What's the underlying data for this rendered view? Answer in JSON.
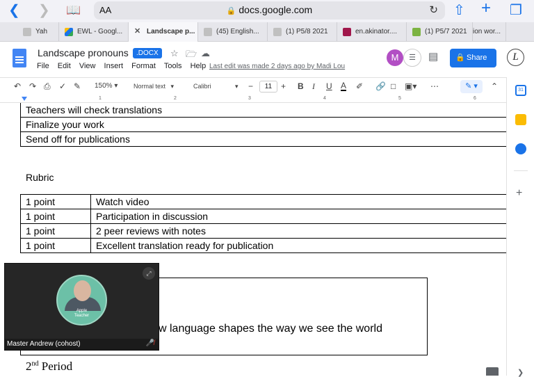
{
  "safari": {
    "aa": "AA",
    "url": "docs.google.com",
    "lock_icon": "lock-icon"
  },
  "tabs": [
    {
      "label": "Yah",
      "color": "#d93025"
    },
    {
      "label": "EWL - Googl...",
      "color": "#1a73e8"
    },
    {
      "label": "Landscape p...",
      "color": "#5f6368"
    },
    {
      "label": "(45) English...",
      "color": "#c0c0c0"
    },
    {
      "label": "(1) P5/8 2021",
      "color": "#c0c0c0"
    },
    {
      "label": "en.akinator....",
      "color": "#a0174b"
    },
    {
      "label": "(1) P5/7 2021",
      "color": "#7cb342"
    },
    {
      "label": "ion wor...",
      "color": "#c0c0c0"
    }
  ],
  "doc": {
    "title": "Landscape pronouns",
    "badge": ".DOCX",
    "last_edit": "Last edit was made 2 days ago by Madi Lou",
    "menu": [
      "File",
      "Edit",
      "View",
      "Insert",
      "Format",
      "Tools",
      "Help"
    ],
    "share_label": "Share",
    "avatar_initial": "M",
    "user_initial": "L"
  },
  "toolbar": {
    "zoom": "150%",
    "style": "Normal text",
    "font": "Calibri",
    "font_size": "11"
  },
  "ruler": {
    "numbers": [
      "1",
      "2",
      "3",
      "4",
      "5",
      "6"
    ]
  },
  "content": {
    "steps": [
      "Teachers will check translations",
      "Finalize your work",
      "Send off for publications"
    ],
    "rubric_heading": "Rubric",
    "rubric": [
      {
        "points": "1 point",
        "item": "Watch video"
      },
      {
        "points": "1 point",
        "item": "Participation in discussion"
      },
      {
        "points": "1 point",
        "item": "2 peer reviews with notes"
      },
      {
        "points": "1 point",
        "item": "Excellent translation ready for publication"
      }
    ],
    "partial_line": "w language shapes the way we see the world",
    "period_num": "2",
    "period_sup": "nd",
    "period_word": "Period"
  },
  "video": {
    "name": "Master Andrew (cohost)",
    "badge_line1": "Apple",
    "badge_line2": "Teacher"
  },
  "colors": {
    "accent": "#1a73e8",
    "avatar_m": "#b24fc4"
  }
}
